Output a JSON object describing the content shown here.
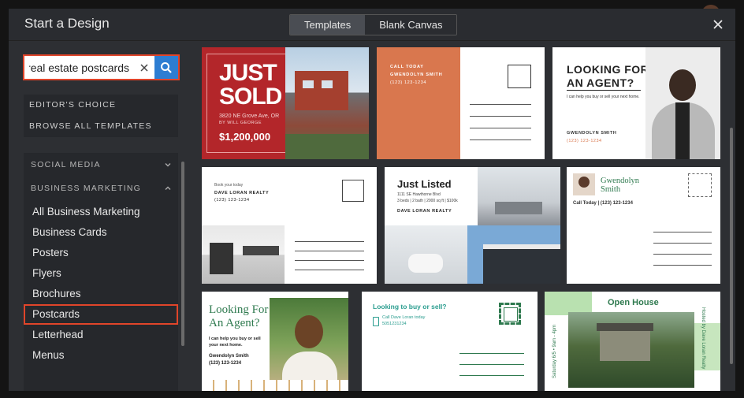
{
  "modal": {
    "title": "Start a Design"
  },
  "tabs": [
    {
      "label": "Templates",
      "active": true
    },
    {
      "label": "Blank Canvas",
      "active": false
    }
  ],
  "search": {
    "value": "real estate postcards",
    "placeholder": ""
  },
  "sidebar": {
    "top_items": [
      "EDITOR'S CHOICE",
      "BROWSE ALL TEMPLATES"
    ],
    "categories": [
      {
        "label": "SOCIAL MEDIA",
        "expanded": false
      },
      {
        "label": "BUSINESS MARKETING",
        "expanded": true
      }
    ],
    "sub_items": [
      {
        "label": "All Business Marketing",
        "selected": false
      },
      {
        "label": "Business Cards",
        "selected": false
      },
      {
        "label": "Posters",
        "selected": false
      },
      {
        "label": "Flyers",
        "selected": false
      },
      {
        "label": "Brochures",
        "selected": false
      },
      {
        "label": "Postcards",
        "selected": true
      },
      {
        "label": "Letterhead",
        "selected": false
      },
      {
        "label": "Menus",
        "selected": false
      }
    ]
  },
  "templates": {
    "t1": {
      "line1": "JUST",
      "line2": "SOLD",
      "address": "3820 NE Grove Ave, OR",
      "agent": "BY WILL GEORGE",
      "price": "$1,200,000"
    },
    "t2": {
      "call": "CALL TODAY",
      "name": "GWENDOLYN SMITH",
      "phone": "(123) 123-1234"
    },
    "t3": {
      "heading1": "LOOKING FOR",
      "heading2": "AN AGENT?",
      "tagline": "I can help you buy or sell your next home.",
      "name": "GWENDOLYN SMITH",
      "phone": "(123) 123-1234"
    },
    "t4": {
      "book": "Book your today",
      "name": "DAVE LORAN REALTY",
      "phone": "(123) 123-1234"
    },
    "t5": {
      "heading": "Just Listed",
      "address": "1111 SE Hawthorne Blvd",
      "details": "3 beds | 2 bath | 2000 sq ft | $100k",
      "name": "DAVE LORAN REALTY"
    },
    "t6": {
      "first": "Gwendolyn",
      "last": "Smith",
      "call": "Call Today | (123) 123-1234"
    },
    "t7": {
      "heading1": "Looking For",
      "heading2": "An Agent?",
      "tagline": "I can help you buy or sell your next home.",
      "name": "Gwendolyn Smith",
      "phone": "(123) 123-1234"
    },
    "t8": {
      "heading": "Looking to buy or sell?",
      "call": "Call Dave Loran today",
      "phone": "5051231234"
    },
    "t9": {
      "heading": "Open House",
      "date": "Saturday 6/5 • 9am - 4pm",
      "host": "Hosted by Dave Loran Realty"
    }
  },
  "colors": {
    "accent_red": "#e0452a",
    "search_blue": "#2d7dd2",
    "sold_red": "#b3262a",
    "terracotta": "#d9774e",
    "green": "#2f7a4f"
  }
}
